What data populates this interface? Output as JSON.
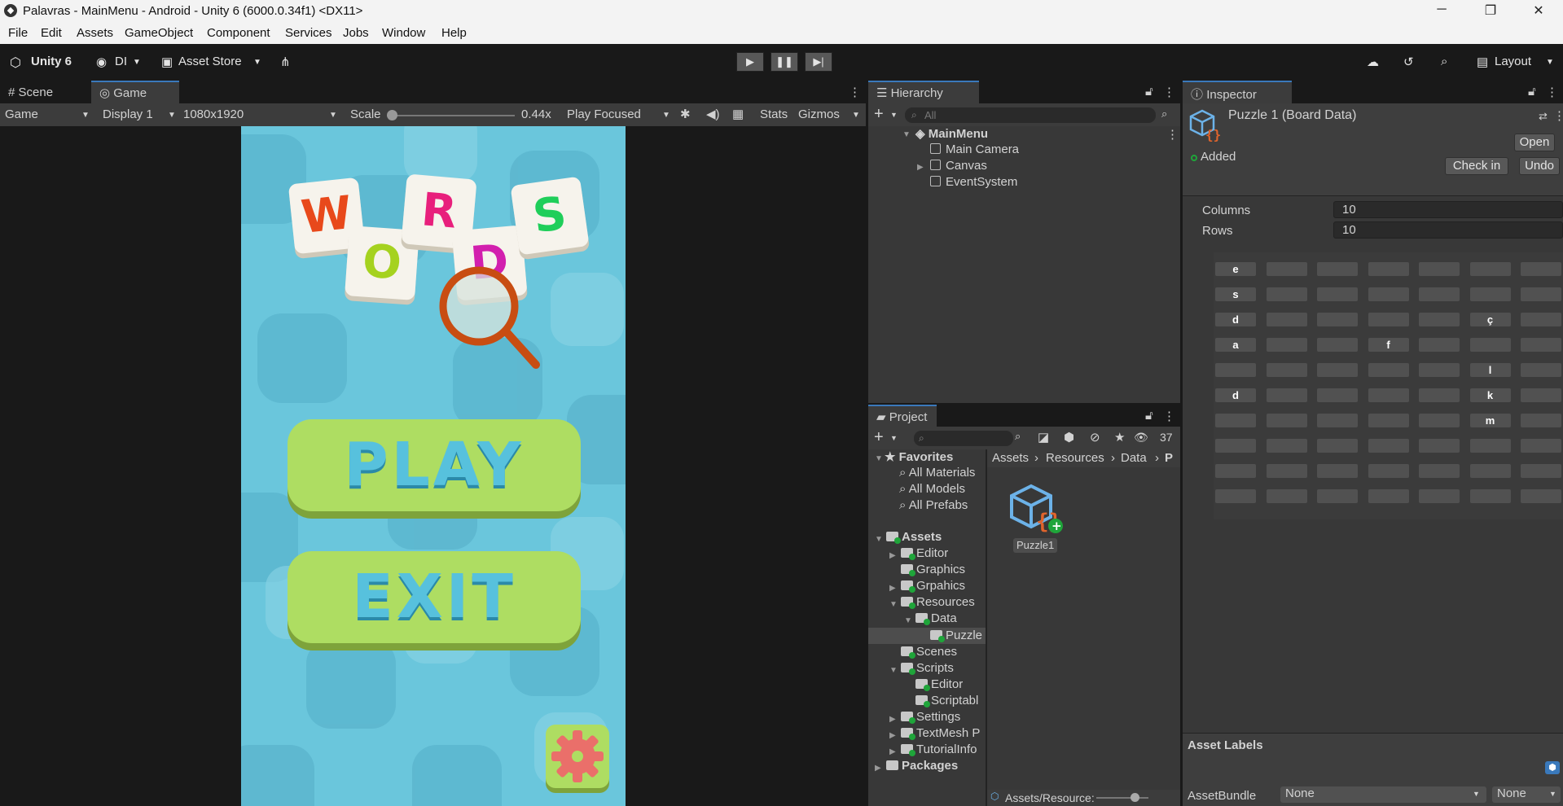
{
  "window": {
    "title": "Palavras - MainMenu - Android - Unity 6 (6000.0.34f1) <DX11>",
    "minimize": "─",
    "maximize": "❐",
    "close": "✕"
  },
  "menubar": [
    "File",
    "Edit",
    "Assets",
    "GameObject",
    "Component",
    "Services",
    "Jobs",
    "Window",
    "Help"
  ],
  "toolbar": {
    "unity_label": "Unity 6",
    "account": "DI",
    "asset_store": "Asset Store",
    "layout": "Layout"
  },
  "game_panel": {
    "tabs": [
      "Scene",
      "Game"
    ],
    "active_tab": "Game",
    "mode": "Game",
    "display": "Display 1",
    "resolution": "1080x1920",
    "scale_label": "Scale",
    "scale_value": "0.44x",
    "play_focused": "Play Focused",
    "stats": "Stats",
    "gizmos": "Gizmos"
  },
  "game_screen": {
    "logo_letters": [
      "W",
      "O",
      "R",
      "D",
      "S"
    ],
    "logo_colors": [
      "#e8491b",
      "#a5d21f",
      "#e81f7c",
      "#d21fae",
      "#1fce5a"
    ],
    "play_button": "PLAY",
    "exit_button": "EXIT",
    "settings_icon": "gear-icon"
  },
  "hierarchy": {
    "tab": "Hierarchy",
    "search_placeholder": "All",
    "scene": "MainMenu",
    "items": [
      "Main Camera",
      "Canvas",
      "EventSystem"
    ]
  },
  "project": {
    "tab": "Project",
    "hidden_count": "37",
    "favorites_label": "Favorites",
    "favorites": [
      "All Materials",
      "All Models",
      "All Prefabs"
    ],
    "assets_label": "Assets",
    "tree": [
      "Editor",
      "Graphics",
      "Grpahics",
      "Resources",
      "Data",
      "Puzzle",
      "Scenes",
      "Scripts",
      "Editor",
      "Scriptabl",
      "Settings",
      "TextMesh P",
      "TutorialInfo"
    ],
    "packages_label": "Packages",
    "breadcrumb": [
      "Assets",
      "Resources",
      "Data",
      "P"
    ],
    "asset_name": "Puzzle1",
    "footer_path": "Assets/Resource:"
  },
  "inspector": {
    "tab": "Inspector",
    "object_title": "Puzzle 1 (Board Data)",
    "open_button": "Open",
    "added_label": "Added",
    "checkin_button": "Check in",
    "undo_button": "Undo",
    "columns_label": "Columns",
    "columns_value": "10",
    "rows_label": "Rows",
    "rows_value": "10",
    "grid": [
      [
        "e",
        "",
        "",
        "",
        "",
        "",
        ""
      ],
      [
        "s",
        "",
        "",
        "",
        "",
        "",
        ""
      ],
      [
        "d",
        "",
        "",
        "",
        "",
        "ç",
        ""
      ],
      [
        "a",
        "",
        "",
        "f",
        "",
        "",
        ""
      ],
      [
        "",
        "",
        "",
        "",
        "",
        "l",
        ""
      ],
      [
        "d",
        "",
        "",
        "",
        "",
        "k",
        ""
      ],
      [
        "",
        "",
        "",
        "",
        "",
        "m",
        ""
      ],
      [
        "",
        "",
        "",
        "",
        "",
        "",
        ""
      ],
      [
        "",
        "",
        "",
        "",
        "",
        "",
        ""
      ],
      [
        "",
        "",
        "",
        "",
        "",
        "",
        ""
      ]
    ],
    "asset_labels": "Asset Labels",
    "assetbundle_label": "AssetBundle",
    "assetbundle_value": "None",
    "variant_value": "None"
  }
}
